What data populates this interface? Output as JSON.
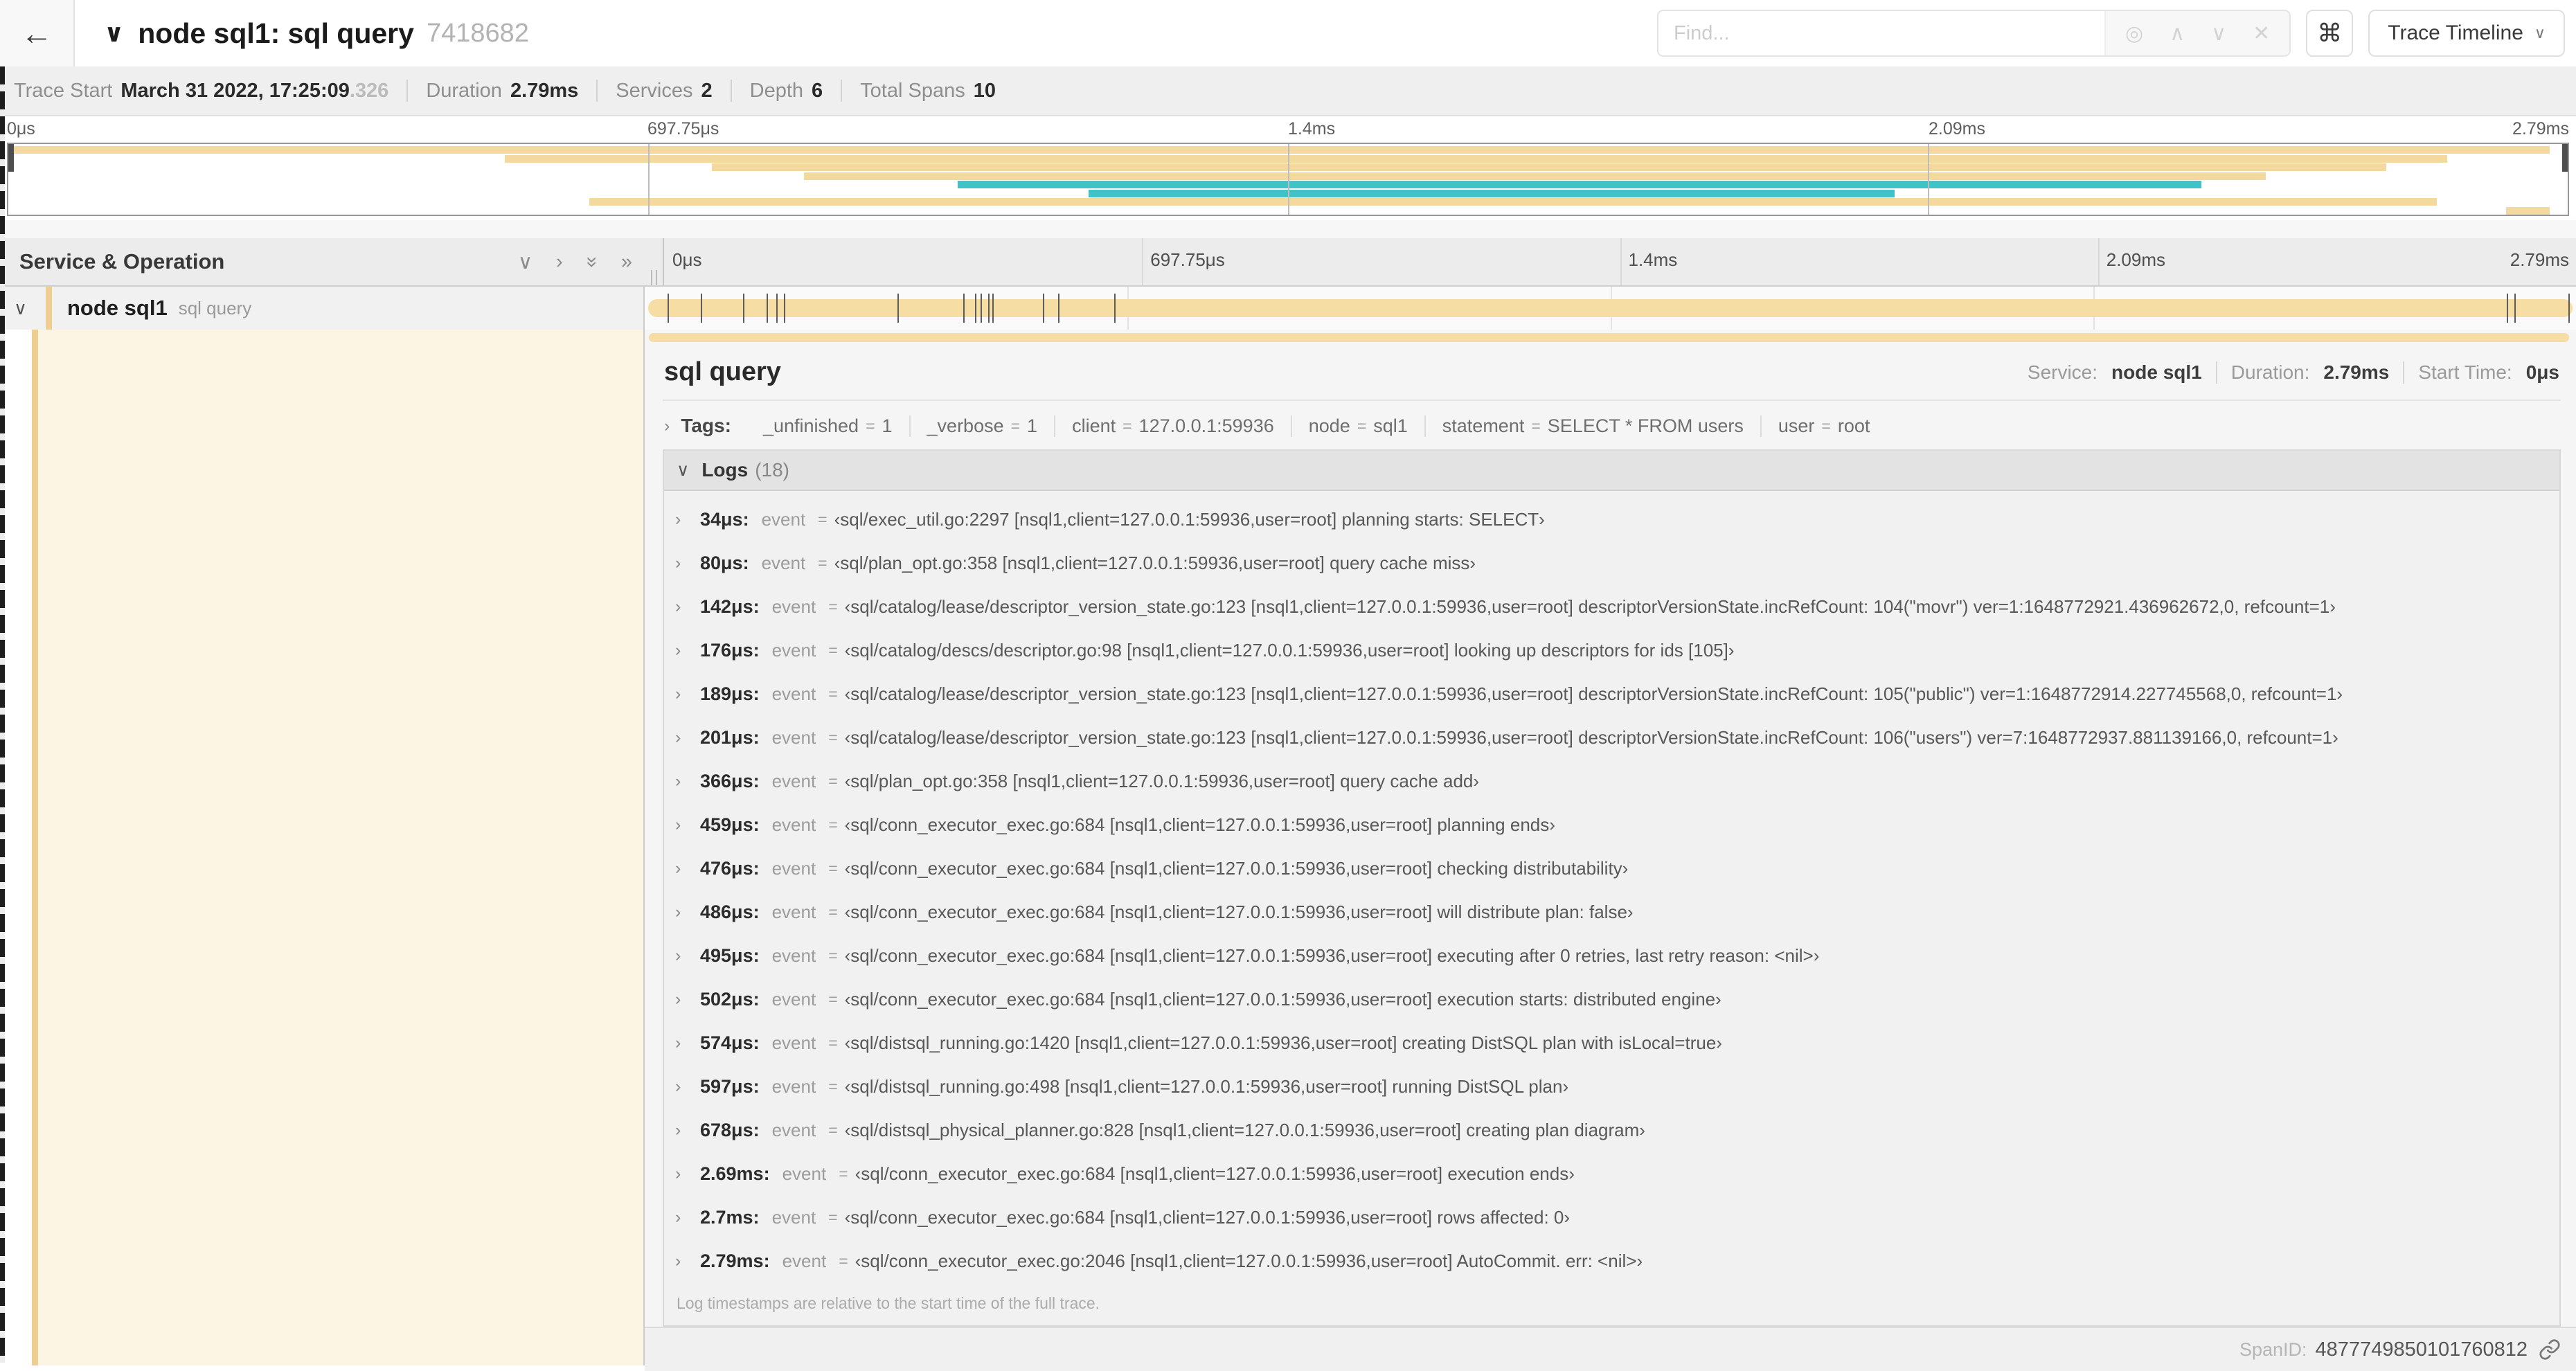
{
  "icons": {
    "back": "←",
    "chevron_down": "∨",
    "chevron_right": "›",
    "chevron_up": "∧",
    "double_chevron_right": "»",
    "target": "◎",
    "close": "✕",
    "cmd": "⌘"
  },
  "ui": {
    "eq": "="
  },
  "colors": {
    "span_bar_tan": "#f6dda4",
    "minimap_tan": "#f3d99e",
    "span_bar_teal": "#3fc3c6",
    "accent_strip": "#eecf91",
    "detail_left_bg": "#fcf5e3"
  },
  "header": {
    "title": "node sql1: sql query",
    "trace_id": "7418682",
    "find_placeholder": "Find...",
    "view_button": "Trace Timeline"
  },
  "summary": {
    "trace_start_label": "Trace Start",
    "trace_start": "March 31 2022, 17:25:09",
    "trace_start_frac": ".326",
    "duration_label": "Duration",
    "duration": "2.79ms",
    "services_label": "Services",
    "services": "2",
    "depth_label": "Depth",
    "depth": "6",
    "total_spans_label": "Total Spans",
    "total_spans": "10"
  },
  "minimap": {
    "rows": [
      {
        "start": 0,
        "end": 99.3,
        "color": "tan"
      },
      {
        "start": 19.4,
        "end": 95.3,
        "color": "tan"
      },
      {
        "start": 27.5,
        "end": 92.9,
        "color": "tan"
      },
      {
        "start": 31.1,
        "end": 88.2,
        "color": "tan"
      },
      {
        "start": 37.1,
        "end": 85.7,
        "color": "teal"
      },
      {
        "start": 42.2,
        "end": 73.7,
        "color": "teal"
      },
      {
        "start": 22.7,
        "end": 94.9,
        "color": "tan"
      },
      {
        "start": 97.6,
        "end": 99.3,
        "color": "tan"
      }
    ]
  },
  "timeline": {
    "ticks": [
      "0μs",
      "697.75μs",
      "1.4ms",
      "2.09ms",
      "2.79ms"
    ],
    "service_operation_label": "Service & Operation",
    "span": {
      "service": "node sql1",
      "operation": "sql query"
    },
    "log_tick_pcts": [
      1.2,
      2.9,
      5.1,
      6.3,
      6.8,
      7.2,
      13.1,
      16.5,
      17.1,
      17.4,
      17.8,
      18.0,
      20.6,
      21.4,
      24.3,
      96.4,
      96.8,
      99.6
    ]
  },
  "detail": {
    "title": "sql query",
    "meta": [
      {
        "label": "Service:",
        "value": "node sql1"
      },
      {
        "label": "Duration:",
        "value": "2.79ms"
      },
      {
        "label": "Start Time:",
        "value": "0μs"
      }
    ],
    "tags": {
      "label": "Tags:",
      "items": [
        {
          "key": "_unfinished",
          "value": "1"
        },
        {
          "key": "_verbose",
          "value": "1"
        },
        {
          "key": "client",
          "value": "127.0.0.1:59936"
        },
        {
          "key": "node",
          "value": "sql1"
        },
        {
          "key": "statement",
          "value": "SELECT * FROM users"
        },
        {
          "key": "user",
          "value": "root"
        }
      ]
    },
    "logs": {
      "label": "Logs",
      "count": "(18)",
      "entries": [
        {
          "time": "34μs",
          "key": "event",
          "value": "‹sql/exec_util.go:2297 [nsql1,client=127.0.0.1:59936,user=root] planning starts: SELECT›"
        },
        {
          "time": "80μs",
          "key": "event",
          "value": "‹sql/plan_opt.go:358 [nsql1,client=127.0.0.1:59936,user=root] query cache miss›"
        },
        {
          "time": "142μs",
          "key": "event",
          "value": "‹sql/catalog/lease/descriptor_version_state.go:123 [nsql1,client=127.0.0.1:59936,user=root] descriptorVersionState.incRefCount: 104(\"movr\") ver=1:1648772921.436962672,0, refcount=1›"
        },
        {
          "time": "176μs",
          "key": "event",
          "value": "‹sql/catalog/descs/descriptor.go:98 [nsql1,client=127.0.0.1:59936,user=root] looking up descriptors for ids [105]›"
        },
        {
          "time": "189μs",
          "key": "event",
          "value": "‹sql/catalog/lease/descriptor_version_state.go:123 [nsql1,client=127.0.0.1:59936,user=root] descriptorVersionState.incRefCount: 105(\"public\") ver=1:1648772914.227745568,0, refcount=1›"
        },
        {
          "time": "201μs",
          "key": "event",
          "value": "‹sql/catalog/lease/descriptor_version_state.go:123 [nsql1,client=127.0.0.1:59936,user=root] descriptorVersionState.incRefCount: 106(\"users\") ver=7:1648772937.881139166,0, refcount=1›"
        },
        {
          "time": "366μs",
          "key": "event",
          "value": "‹sql/plan_opt.go:358 [nsql1,client=127.0.0.1:59936,user=root] query cache add›"
        },
        {
          "time": "459μs",
          "key": "event",
          "value": "‹sql/conn_executor_exec.go:684 [nsql1,client=127.0.0.1:59936,user=root] planning ends›"
        },
        {
          "time": "476μs",
          "key": "event",
          "value": "‹sql/conn_executor_exec.go:684 [nsql1,client=127.0.0.1:59936,user=root] checking distributability›"
        },
        {
          "time": "486μs",
          "key": "event",
          "value": "‹sql/conn_executor_exec.go:684 [nsql1,client=127.0.0.1:59936,user=root] will distribute plan: false›"
        },
        {
          "time": "495μs",
          "key": "event",
          "value": "‹sql/conn_executor_exec.go:684 [nsql1,client=127.0.0.1:59936,user=root] executing after 0 retries, last retry reason: <nil>›"
        },
        {
          "time": "502μs",
          "key": "event",
          "value": "‹sql/conn_executor_exec.go:684 [nsql1,client=127.0.0.1:59936,user=root] execution starts: distributed engine›"
        },
        {
          "time": "574μs",
          "key": "event",
          "value": "‹sql/distsql_running.go:1420 [nsql1,client=127.0.0.1:59936,user=root] creating DistSQL plan with isLocal=true›"
        },
        {
          "time": "597μs",
          "key": "event",
          "value": "‹sql/distsql_running.go:498 [nsql1,client=127.0.0.1:59936,user=root] running DistSQL plan›"
        },
        {
          "time": "678μs",
          "key": "event",
          "value": "‹sql/distsql_physical_planner.go:828 [nsql1,client=127.0.0.1:59936,user=root] creating plan diagram›"
        },
        {
          "time": "2.69ms",
          "key": "event",
          "value": "‹sql/conn_executor_exec.go:684 [nsql1,client=127.0.0.1:59936,user=root] execution ends›"
        },
        {
          "time": "2.7ms",
          "key": "event",
          "value": "‹sql/conn_executor_exec.go:684 [nsql1,client=127.0.0.1:59936,user=root] rows affected: 0›"
        },
        {
          "time": "2.79ms",
          "key": "event",
          "value": "‹sql/conn_executor_exec.go:2046 [nsql1,client=127.0.0.1:59936,user=root] AutoCommit. err: <nil>›"
        }
      ],
      "footnote": "Log timestamps are relative to the start time of the full trace."
    },
    "span_id_label": "SpanID:",
    "span_id": "4877749850101760812"
  }
}
